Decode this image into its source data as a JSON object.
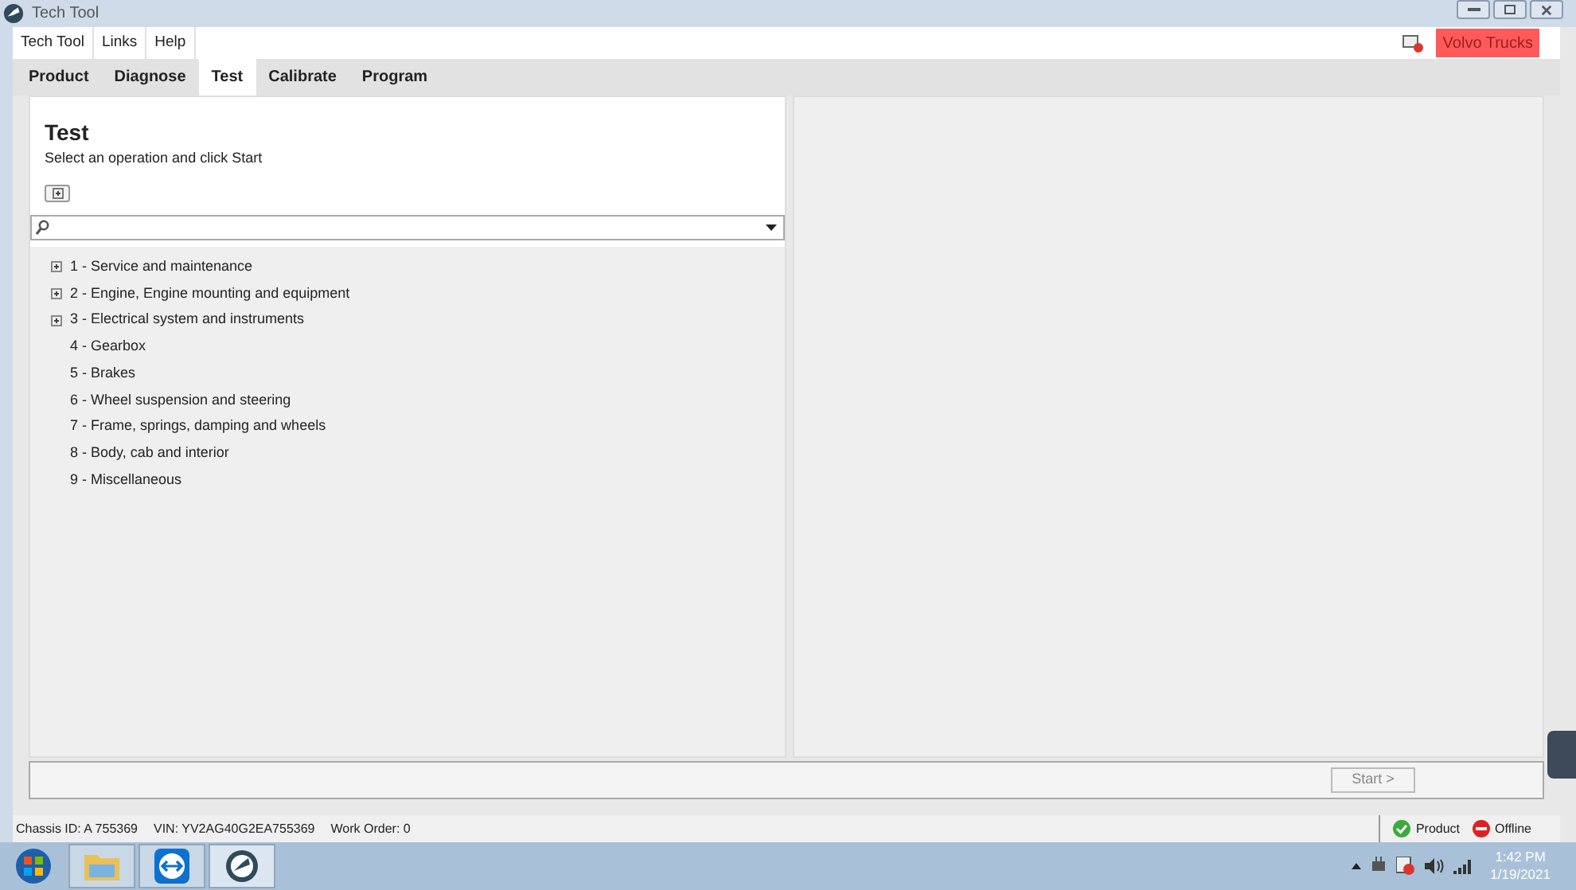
{
  "window": {
    "title": "Tech Tool"
  },
  "menu": [
    "Tech Tool",
    "Links",
    "Help"
  ],
  "brand_badge": "Volvo Trucks",
  "tabs": [
    {
      "label": "Product",
      "selected": false
    },
    {
      "label": "Diagnose",
      "selected": false
    },
    {
      "label": "Test",
      "selected": true
    },
    {
      "label": "Calibrate",
      "selected": false
    },
    {
      "label": "Program",
      "selected": false
    }
  ],
  "panel": {
    "title": "Test",
    "subtitle": "Select an operation and click Start"
  },
  "tree": [
    {
      "label": "1 - Service and maintenance",
      "kind": "group"
    },
    {
      "label": "2 - Engine, Engine mounting and equipment",
      "kind": "group"
    },
    {
      "label": "3 - Electrical system and instruments",
      "kind": "group"
    },
    {
      "label": "4 - Gearbox",
      "kind": "leaf"
    },
    {
      "label": "5 - Brakes",
      "kind": "leaf"
    },
    {
      "label": "6 - Wheel suspension and steering",
      "kind": "leaf"
    },
    {
      "label": "7 - Frame, springs, damping and wheels",
      "kind": "leaf"
    },
    {
      "label": "8 - Body, cab and interior",
      "kind": "leaf"
    },
    {
      "label": "9 - Miscellaneous",
      "kind": "leaf"
    }
  ],
  "start_button": {
    "label": "Start >",
    "disabled": true
  },
  "status_bar": {
    "chassis": "Chassis ID: A 755369",
    "vin": "VIN: YV2AG40G2EA755369",
    "work_order": "Work Order: 0",
    "product": "Product",
    "connection": "Offline"
  },
  "taskbar": {
    "time": "1:42 PM",
    "date": "1/19/2021"
  }
}
